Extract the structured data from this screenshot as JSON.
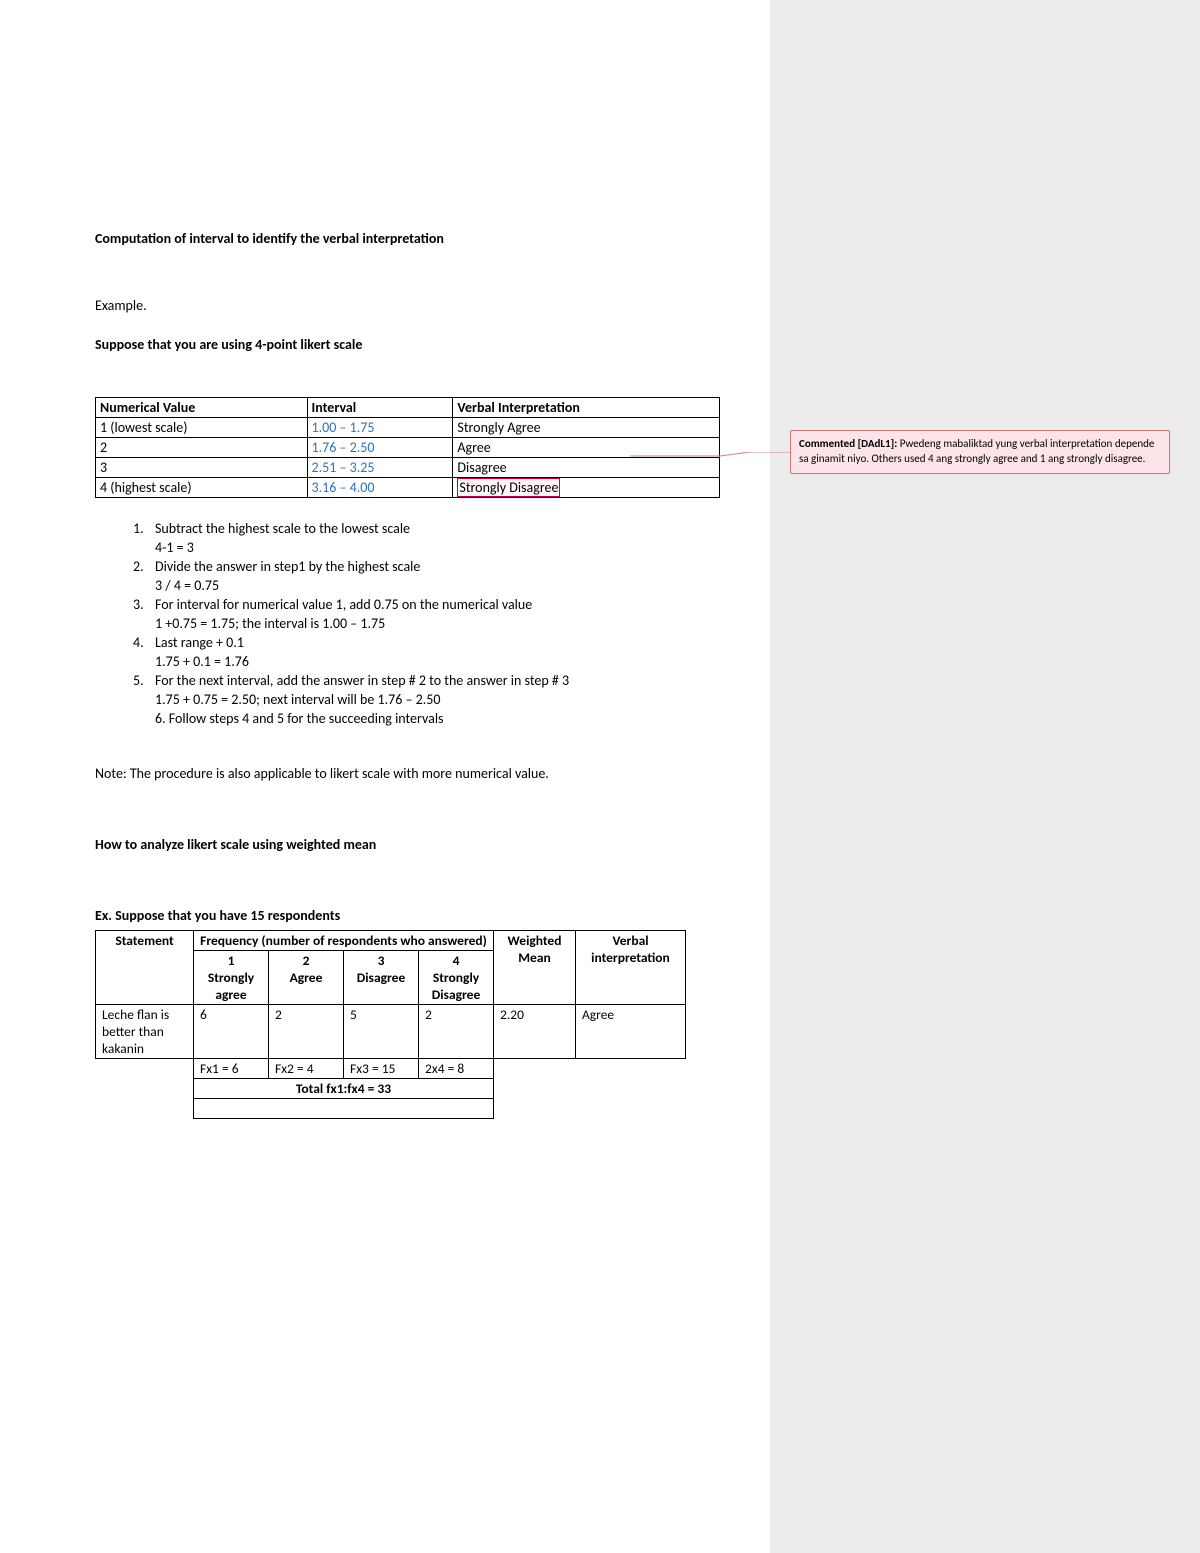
{
  "title": "Computation of interval to identify the verbal interpretation",
  "example_label": "Example.",
  "suppose": "Suppose that you are using 4-point likert scale",
  "interval_table": {
    "headers": [
      "Numerical Value",
      "Interval",
      "Verbal Interpretation"
    ],
    "rows": [
      {
        "num": "1 (lowest scale)",
        "interval": "1.00 – 1.75",
        "verbal": "Strongly Agree"
      },
      {
        "num": "2",
        "interval": "1.76 – 2.50",
        "verbal": "Agree"
      },
      {
        "num": "3",
        "interval": "2.51 – 3.25",
        "verbal": "Disagree"
      },
      {
        "num": "4 (highest scale)",
        "interval": "3.16 – 4.00",
        "verbal": "Strongly Disagree"
      }
    ]
  },
  "steps": [
    {
      "n": "1.",
      "t": "Subtract the highest scale to the lowest scale",
      "s": "4-1 = 3"
    },
    {
      "n": "2.",
      "t": "Divide the answer in step1 by the highest scale",
      "s": "3 / 4 = 0.75"
    },
    {
      "n": "3.",
      "t": "For interval for numerical value 1, add 0.75 on the numerical value",
      "s": "1 +0.75 = 1.75; the interval is 1.00 – 1.75"
    },
    {
      "n": "4.",
      "t": "Last range + 0.1",
      "s": "1.75 + 0.1 = 1.76"
    },
    {
      "n": "5.",
      "t": "For the next interval, add the answer in step # 2 to the answer in step # 3",
      "s": "1.75 + 0.75 = 2.50; next interval will be 1.76 – 2.50"
    }
  ],
  "step6": "6. Follow steps 4 and 5 for the succeeding intervals",
  "note": "Note: The procedure is also applicable to likert scale with more numerical value.",
  "section2": "How to analyze likert scale using weighted mean",
  "ex2": "Ex. Suppose that you have 15 respondents",
  "freq_table": {
    "h_statement": "Statement",
    "h_freq": "Frequency (number of respondents who answered)",
    "h_wm": "Weighted Mean",
    "h_vi": "Verbal interpretation",
    "c1a": "1",
    "c1b": "Strongly agree",
    "c2a": "2",
    "c2b": "Agree",
    "c3a": "3",
    "c3b": "Disagree",
    "c4a": "4",
    "c4b": "Strongly Disagree",
    "row_stmt": "Leche flan is better than kakanin",
    "row_v1": "6",
    "row_v2": "2",
    "row_v3": "5",
    "row_v4": "2",
    "row_wm": "2.20",
    "row_vi": "Agree",
    "fx1": "Fx1 = 6",
    "fx2": "Fx2 = 4",
    "fx3": "Fx3 = 15",
    "fx4": "2x4 = 8",
    "total": "Total fx1:fx4 = 33"
  },
  "comment": {
    "label": "Commented [DAdL1]: ",
    "text": "Pwedeng mabaliktad yung verbal interpretation depende sa ginamit niyo. Others used 4 ang strongly agree and 1 ang strongly disagree."
  }
}
